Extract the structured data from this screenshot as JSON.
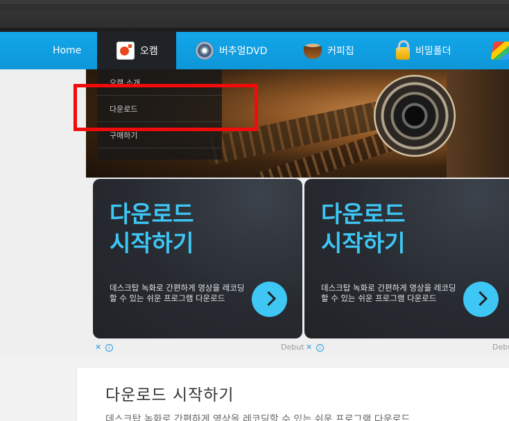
{
  "nav": {
    "home": "Home",
    "items": [
      {
        "label": "오캠",
        "icon": "ocam-icon"
      },
      {
        "label": "버추얼DVD",
        "icon": "dvd-icon"
      },
      {
        "label": "커피집",
        "icon": "coffee-cup-icon"
      },
      {
        "label": "비밀폴더",
        "icon": "padlock-icon"
      },
      {
        "label": "",
        "icon": "paint-icon"
      }
    ]
  },
  "dropdown": {
    "items": [
      "오캠 소개",
      "다운로드",
      "구매하기"
    ]
  },
  "cards": [
    {
      "title_line1": "다운로드",
      "title_line2": "시작하기",
      "desc": "데스크탑 녹화로 간편하게 영상을 레코딩할 수 있는 쉬운 프로그램 다운로드"
    },
    {
      "title_line1": "다운로드",
      "title_line2": "시작하기",
      "desc": "데스크탑 녹화로 간편하게 영상을 레코딩할 수 있는 쉬운 프로그램 다운로드"
    }
  ],
  "ad": {
    "close": "✕",
    "info": "i",
    "debut": "Debut"
  },
  "section": {
    "heading": "다운로드 시작하기",
    "subtext": "데스크탑 녹화로 간편하게 영상을 레코딩할 수 있는 쉬운 프로그램 다운로드"
  },
  "colors": {
    "nav_bg": "#12a7ea",
    "accent": "#3ec7f5",
    "highlight": "#f20b0b"
  }
}
